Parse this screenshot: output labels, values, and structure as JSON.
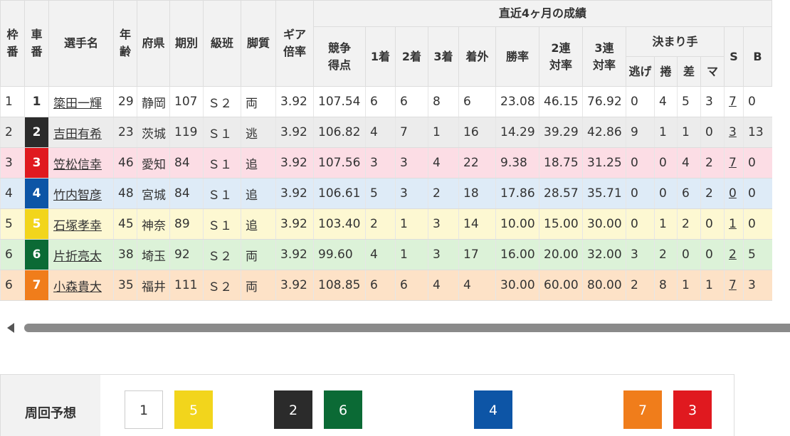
{
  "header": {
    "waku": "枠番",
    "sha": "車番",
    "name": "選手名",
    "age": "年齢",
    "pref": "府県",
    "term": "期別",
    "klass": "級班",
    "leg": "脚質",
    "gear": "ギア倍率",
    "recent": "直近4ヶ月の成績",
    "score": "競争得点",
    "first": "1着",
    "second": "2着",
    "third": "3着",
    "out": "着外",
    "win": "勝率",
    "rate2": "2連対率",
    "rate3": "3連対率",
    "kimari": "決まり手",
    "nige": "逃げ",
    "makuri": "捲",
    "sashi": "差",
    "mark": "マ",
    "s": "S",
    "b": "B"
  },
  "rows": [
    {
      "waku": "1",
      "sha": "1",
      "name": "簗田一輝",
      "age": "29",
      "pref": "静岡",
      "term": "107",
      "klass": "Ｓ２",
      "leg": "両",
      "gear": "3.92",
      "score": "107.54",
      "first": "6",
      "second": "6",
      "third": "8",
      "out": "6",
      "win": "23.08",
      "rate2": "46.15",
      "rate3": "76.92",
      "nige": "0",
      "makuri": "4",
      "sashi": "5",
      "mark": "3",
      "s": "7",
      "b": "0",
      "car_bg": "#ffffff",
      "car_fg": "#333333",
      "row_bg": "#ffffff"
    },
    {
      "waku": "2",
      "sha": "2",
      "name": "吉田有希",
      "age": "23",
      "pref": "茨城",
      "term": "119",
      "klass": "Ｓ１",
      "leg": "逃",
      "gear": "3.92",
      "score": "106.82",
      "first": "4",
      "second": "7",
      "third": "1",
      "out": "16",
      "win": "14.29",
      "rate2": "39.29",
      "rate3": "42.86",
      "nige": "9",
      "makuri": "1",
      "sashi": "1",
      "mark": "0",
      "s": "3",
      "b": "13",
      "car_bg": "#2b2b2b",
      "car_fg": "#ffffff",
      "row_bg": "#ececec"
    },
    {
      "waku": "3",
      "sha": "3",
      "name": "笠松信幸",
      "age": "46",
      "pref": "愛知",
      "term": "84",
      "klass": "Ｓ１",
      "leg": "追",
      "gear": "3.92",
      "score": "107.56",
      "first": "3",
      "second": "3",
      "third": "4",
      "out": "22",
      "win": "9.38",
      "rate2": "18.75",
      "rate3": "31.25",
      "nige": "0",
      "makuri": "0",
      "sashi": "4",
      "mark": "2",
      "s": "7",
      "b": "0",
      "car_bg": "#e0191f",
      "car_fg": "#ffffff",
      "row_bg": "#fcdde5"
    },
    {
      "waku": "4",
      "sha": "4",
      "name": "竹内智彦",
      "age": "48",
      "pref": "宮城",
      "term": "84",
      "klass": "Ｓ１",
      "leg": "追",
      "gear": "3.92",
      "score": "106.61",
      "first": "5",
      "second": "3",
      "third": "2",
      "out": "18",
      "win": "17.86",
      "rate2": "28.57",
      "rate3": "35.71",
      "nige": "0",
      "makuri": "0",
      "sashi": "6",
      "mark": "2",
      "s": "0",
      "b": "0",
      "car_bg": "#0d55a6",
      "car_fg": "#ffffff",
      "row_bg": "#deebf7"
    },
    {
      "waku": "5",
      "sha": "5",
      "name": "石塚孝幸",
      "age": "45",
      "pref": "神奈",
      "term": "89",
      "klass": "Ｓ１",
      "leg": "追",
      "gear": "3.92",
      "score": "103.40",
      "first": "2",
      "second": "1",
      "third": "3",
      "out": "14",
      "win": "10.00",
      "rate2": "15.00",
      "rate3": "30.00",
      "nige": "0",
      "makuri": "1",
      "sashi": "2",
      "mark": "0",
      "s": "1",
      "b": "0",
      "car_bg": "#f2d51c",
      "car_fg": "#ffffff",
      "row_bg": "#fdf8d2"
    },
    {
      "waku": "6",
      "sha": "6",
      "name": "片折亮太",
      "age": "38",
      "pref": "埼玉",
      "term": "92",
      "klass": "Ｓ２",
      "leg": "両",
      "gear": "3.92",
      "score": "99.60",
      "first": "4",
      "second": "1",
      "third": "3",
      "out": "17",
      "win": "16.00",
      "rate2": "20.00",
      "rate3": "32.00",
      "nige": "3",
      "makuri": "2",
      "sashi": "0",
      "mark": "0",
      "s": "2",
      "b": "5",
      "car_bg": "#0b6a35",
      "car_fg": "#ffffff",
      "row_bg": "#dcf2d8"
    },
    {
      "waku": "6",
      "sha": "7",
      "name": "小森貴大",
      "age": "35",
      "pref": "福井",
      "term": "111",
      "klass": "Ｓ２",
      "leg": "両",
      "gear": "3.92",
      "score": "108.85",
      "first": "6",
      "second": "6",
      "third": "4",
      "out": "4",
      "win": "30.00",
      "rate2": "60.00",
      "rate3": "80.00",
      "nige": "2",
      "makuri": "8",
      "sashi": "1",
      "mark": "1",
      "s": "7",
      "b": "3",
      "car_bg": "#f07d1b",
      "car_fg": "#ffffff",
      "row_bg": "#fde2c7"
    }
  ],
  "prediction": {
    "label": "周回予想",
    "items": [
      {
        "num": "1",
        "bg": "#ffffff",
        "fg": "#333333",
        "border": "#cccccc"
      },
      {
        "num": "5",
        "bg": "#f2d51c",
        "fg": "#ffffff",
        "border": "#f2d51c"
      },
      {
        "num": "2",
        "bg": "#2b2b2b",
        "fg": "#ffffff",
        "border": "#2b2b2b"
      },
      {
        "num": "6",
        "bg": "#0b6a35",
        "fg": "#ffffff",
        "border": "#0b6a35"
      },
      {
        "num": "4",
        "bg": "#0d55a6",
        "fg": "#ffffff",
        "border": "#0d55a6"
      },
      {
        "num": "7",
        "bg": "#f07d1b",
        "fg": "#ffffff",
        "border": "#f07d1b"
      },
      {
        "num": "3",
        "bg": "#e0191f",
        "fg": "#ffffff",
        "border": "#e0191f"
      }
    ]
  }
}
